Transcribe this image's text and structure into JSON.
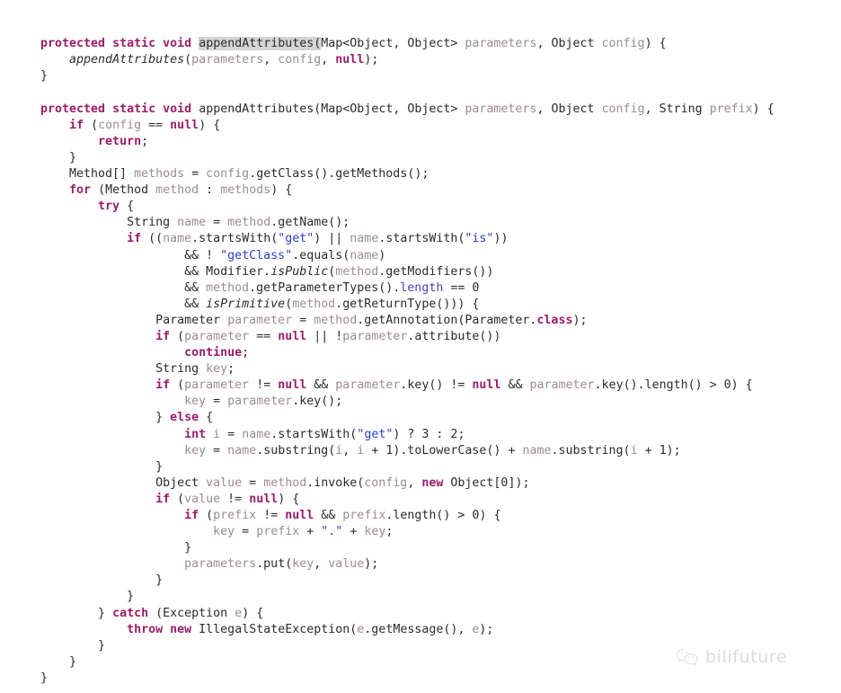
{
  "document": {
    "kind": "source-code-screenshot",
    "language": "Java",
    "theme": "light",
    "colors": {
      "background": "#ffffff",
      "default_text": "#2b2b2b",
      "keyword": "#9b1d68",
      "string": "#2b40c8",
      "field": "#4b3fc0",
      "local_variable": "#9c8b95",
      "parameter": "#9c8b95",
      "selection_highlight": "#d4d4d4",
      "watermark": "#dcdcdc"
    }
  },
  "watermark": {
    "icon": "wechat-icon",
    "text": "bilifuture"
  },
  "code": {
    "lines": [
      "protected static void appendAttributes(Map<Object, Object> parameters, Object config) {",
      "    appendAttributes(parameters, config, null);",
      "}",
      "",
      "protected static void appendAttributes(Map<Object, Object> parameters, Object config, String prefix) {",
      "    if (config == null) {",
      "        return;",
      "    }",
      "    Method[] methods = config.getClass().getMethods();",
      "    for (Method method : methods) {",
      "        try {",
      "            String name = method.getName();",
      "            if ((name.startsWith(\"get\") || name.startsWith(\"is\"))",
      "                    && ! \"getClass\".equals(name)",
      "                    && Modifier.isPublic(method.getModifiers())",
      "                    && method.getParameterTypes().length == 0",
      "                    && isPrimitive(method.getReturnType())) {",
      "                Parameter parameter = method.getAnnotation(Parameter.class);",
      "                if (parameter == null || !parameter.attribute())",
      "                    continue;",
      "                String key;",
      "                if (parameter != null && parameter.key() != null && parameter.key().length() > 0) {",
      "                    key = parameter.key();",
      "                } else {",
      "                    int i = name.startsWith(\"get\") ? 3 : 2;",
      "                    key = name.substring(i, i + 1).toLowerCase() + name.substring(i + 1);",
      "                }",
      "                Object value = method.invoke(config, new Object[0]);",
      "                if (value != null) {",
      "                    if (prefix != null && prefix.length() > 0) {",
      "                        key = prefix + \".\" + key;",
      "                    }",
      "                    parameters.put(key, value);",
      "                }",
      "            }",
      "        } catch (Exception e) {",
      "            throw new IllegalStateException(e.getMessage(), e);",
      "        }",
      "    }",
      "}"
    ],
    "selected_token": "appendAttributes(",
    "keywords": [
      "protected",
      "static",
      "void",
      "if",
      "return",
      "for",
      "try",
      "catch",
      "else",
      "new",
      "throw",
      "continue",
      "int",
      "null",
      "class"
    ],
    "string_literals": [
      "\"get\"",
      "\"is\"",
      "\"getClass\"",
      "\".\""
    ],
    "numeric_literals": [
      "0",
      "1",
      "2",
      "3"
    ]
  }
}
